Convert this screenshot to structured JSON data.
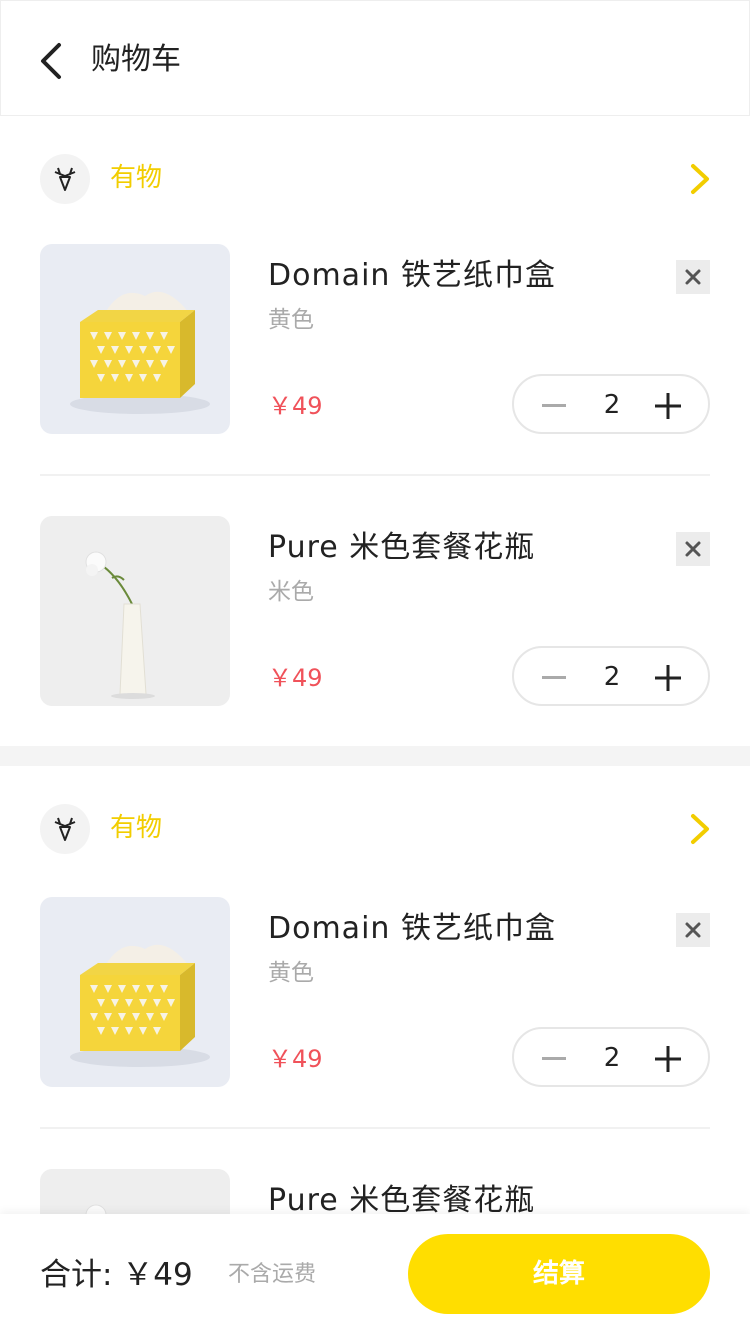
{
  "header": {
    "title": "购物车",
    "back_icon": "chevron-left-icon"
  },
  "stores": [
    {
      "name": "有物",
      "logo_icon": "deer-logo-icon",
      "arrow_icon": "chevron-right-icon",
      "items": [
        {
          "name": "Domain 铁艺纸巾盒",
          "spec": "黄色",
          "price": "￥49",
          "quantity": "2",
          "image": "yellow-tissue-box-image"
        },
        {
          "name": "Pure 米色套餐花瓶",
          "spec": "米色",
          "price": "￥49",
          "quantity": "2",
          "image": "white-vase-image"
        }
      ]
    },
    {
      "name": "有物",
      "logo_icon": "deer-logo-icon",
      "arrow_icon": "chevron-right-icon",
      "items": [
        {
          "name": "Domain 铁艺纸巾盒",
          "spec": "黄色",
          "price": "￥49",
          "quantity": "2",
          "image": "yellow-tissue-box-image"
        },
        {
          "name": "Pure 米色套餐花瓶",
          "spec": "",
          "price": "",
          "quantity": "",
          "image": "white-vase-image"
        }
      ]
    }
  ],
  "footer": {
    "total_label": "合计: ￥49",
    "shipping_note": "不含运费",
    "checkout_label": "结算"
  },
  "colors": {
    "accent": "#ffde00",
    "store_name": "#f2cd00",
    "price": "#f0525a",
    "muted": "#aaaaaa"
  }
}
